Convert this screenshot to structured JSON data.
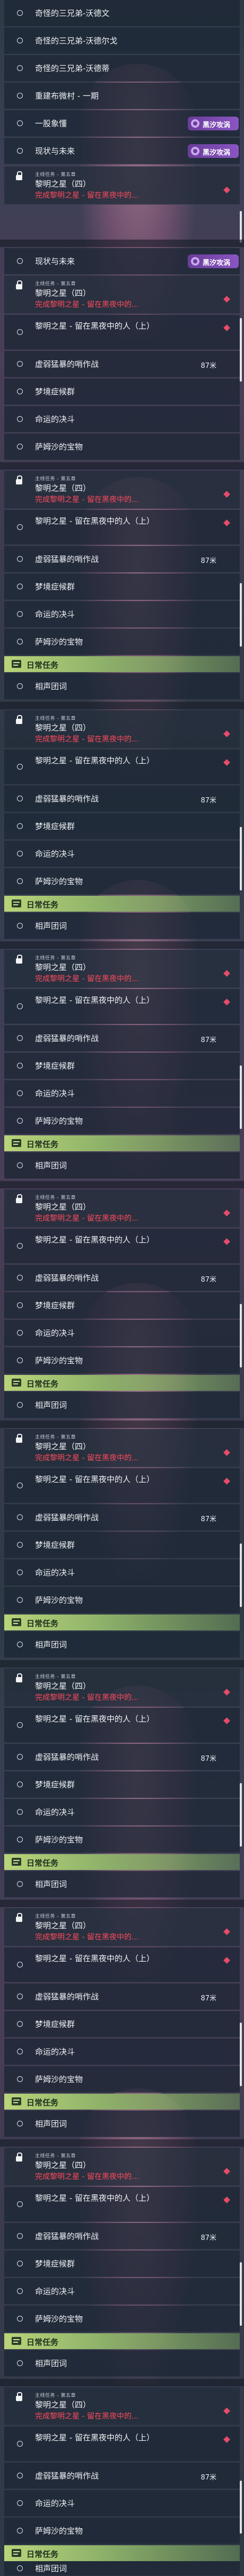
{
  "top_list": {
    "items": [
      {
        "label": "奇怪的三兄弟-沃德文"
      },
      {
        "label": "奇怪的三兄弟-沃德尔戈"
      },
      {
        "label": "奇怪的三兄弟-沃德蒂"
      },
      {
        "label": "重建布微村 - 一期"
      },
      {
        "label": "一股象懂"
      },
      {
        "label": "现状与未来"
      }
    ]
  },
  "quest": {
    "mini_label": "主线任务 - 第五章",
    "title": "黎明之星（四）",
    "subtitle": "完成黎明之星 - 留在黑夜中的...",
    "steps": [
      {
        "label": "黎明之星 - 留在黑夜中的人（上）"
      },
      {
        "label": "虚弱猛暴的哨作战",
        "distance": "87米"
      },
      {
        "label": "梦境症候群"
      },
      {
        "label": "命运的决斗"
      },
      {
        "label": "萨姆沙的宝物"
      }
    ]
  },
  "daily": {
    "label": "日常任务",
    "item": "相声团词"
  },
  "pill": {
    "label": "黑汐攻涡"
  },
  "colors": {
    "accent_red": "#ff4a5c",
    "daily_green": "#b9d47a",
    "pill_purple": "#6a3d9a"
  }
}
